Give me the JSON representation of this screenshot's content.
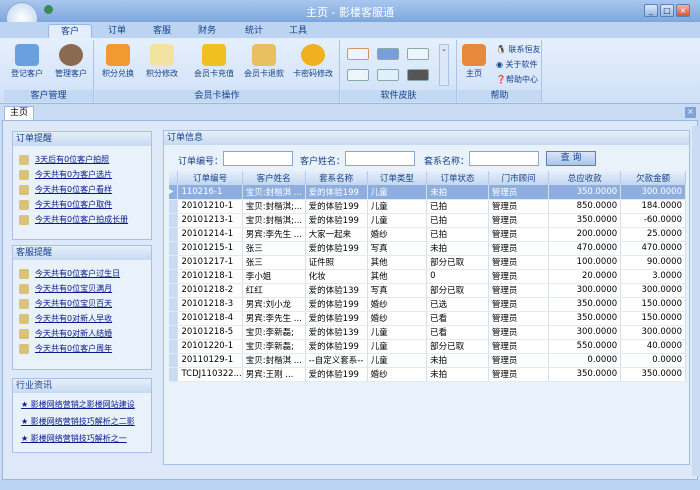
{
  "window": {
    "title": "主页 - 影楼客服通",
    "min": "_",
    "max": "□",
    "close": "×"
  },
  "ribbon_tabs": [
    "客户",
    "订单",
    "客服",
    "财务",
    "统计",
    "工具"
  ],
  "groups": {
    "customer": {
      "label": "客户管理",
      "buttons": [
        "登记客户",
        "管理客户"
      ]
    },
    "card": {
      "label": "会员卡操作",
      "buttons": [
        "积分兑换",
        "积分修改",
        "会员卡充值",
        "会员卡退款",
        "卡密码修改"
      ]
    },
    "skin": {
      "label": "软件皮肤"
    },
    "help": {
      "label": "帮助",
      "home": "主页",
      "items": [
        "联系恒友",
        "关于软件",
        "帮助中心"
      ]
    }
  },
  "doc_tab": "主页",
  "order_reminders": {
    "title": "订单提醒",
    "items": [
      "3天后有0位客户拍照",
      "今天共有0为客户选片",
      "今天共有0位客户看样",
      "今天共有0位客户取件",
      "今天共有0位客户拍成长册"
    ]
  },
  "service_reminders": {
    "title": "客服提醒",
    "items": [
      "今天共有0位客户过生日",
      "今天共有0位宝贝满月",
      "今天共有0位宝贝百天",
      "今天共有0对新人早收",
      "今天共有0对新人结婚",
      "今天共有0位客户周年"
    ]
  },
  "news": {
    "title": "行业资讯",
    "items": [
      "★ 影楼网络营销之影楼网站建设",
      "★ 影楼网络营销技巧解析之二影",
      "★ 影楼网络营销技巧解析之一"
    ]
  },
  "orders": {
    "title": "订单信息",
    "search": {
      "order_no_label": "订单编号：",
      "customer_label": "客户姓名：",
      "package_label": "套系名称：",
      "query": "查 询"
    },
    "columns": [
      "订单编号",
      "客户姓名",
      "套系名称",
      "订单类型",
      "订单状态",
      "门市顾问",
      "总应收款",
      "欠款金额"
    ],
    "rows": [
      [
        "110216-1",
        "宝贝:封楷淇 ...",
        "爱的体验199",
        "儿童",
        "未拍",
        "管理员",
        "350.0000",
        "300.0000"
      ],
      [
        "20101210-1",
        "宝贝:封楷淇;...",
        "爱的体验199",
        "儿童",
        "已拍",
        "管理员",
        "850.0000",
        "184.0000"
      ],
      [
        "20101213-1",
        "宝贝:封楷淇;...",
        "爱的体验199",
        "儿童",
        "已拍",
        "管理员",
        "350.0000",
        "-60.0000"
      ],
      [
        "20101214-1",
        "男宾:李先生 ...",
        "大家一起来",
        "婚纱",
        "已拍",
        "管理员",
        "200.0000",
        "25.0000"
      ],
      [
        "20101215-1",
        "张三",
        "爱的体验199",
        "写真",
        "未拍",
        "管理员",
        "470.0000",
        "470.0000"
      ],
      [
        "20101217-1",
        "张三",
        "证件照",
        "其他",
        "部分已取",
        "管理员",
        "100.0000",
        "90.0000"
      ],
      [
        "20101218-1",
        "李小姐",
        "化妆",
        "其他",
        "0",
        "管理员",
        "20.0000",
        "3.0000"
      ],
      [
        "20101218-2",
        "红红",
        "爱的体验139",
        "写真",
        "部分已取",
        "管理员",
        "300.0000",
        "300.0000"
      ],
      [
        "20101218-3",
        "男宾:刘小龙",
        "爱的体验199",
        "婚纱",
        "已选",
        "管理员",
        "350.0000",
        "150.0000"
      ],
      [
        "20101218-4",
        "男宾:李先生 ...",
        "爱的体验199",
        "婚纱",
        "已看",
        "管理员",
        "350.0000",
        "150.0000"
      ],
      [
        "20101218-5",
        "宝贝:李新磊;",
        "爱的体验139",
        "儿童",
        "已看",
        "管理员",
        "300.0000",
        "300.0000"
      ],
      [
        "20101220-1",
        "宝贝:李新磊;",
        "爱的体验199",
        "儿童",
        "部分已取",
        "管理员",
        "550.0000",
        "40.0000"
      ],
      [
        "20110129-1",
        "宝贝:封楷淇 ...",
        "--自定义套系--",
        "儿童",
        "未拍",
        "管理员",
        "0.0000",
        "0.0000"
      ],
      [
        "TCDJ110322...",
        "男宾:王刚  ...",
        "爱的体验199",
        "婚纱",
        "未拍",
        "管理员",
        "350.0000",
        "350.0000"
      ]
    ],
    "selected_row": 0
  }
}
